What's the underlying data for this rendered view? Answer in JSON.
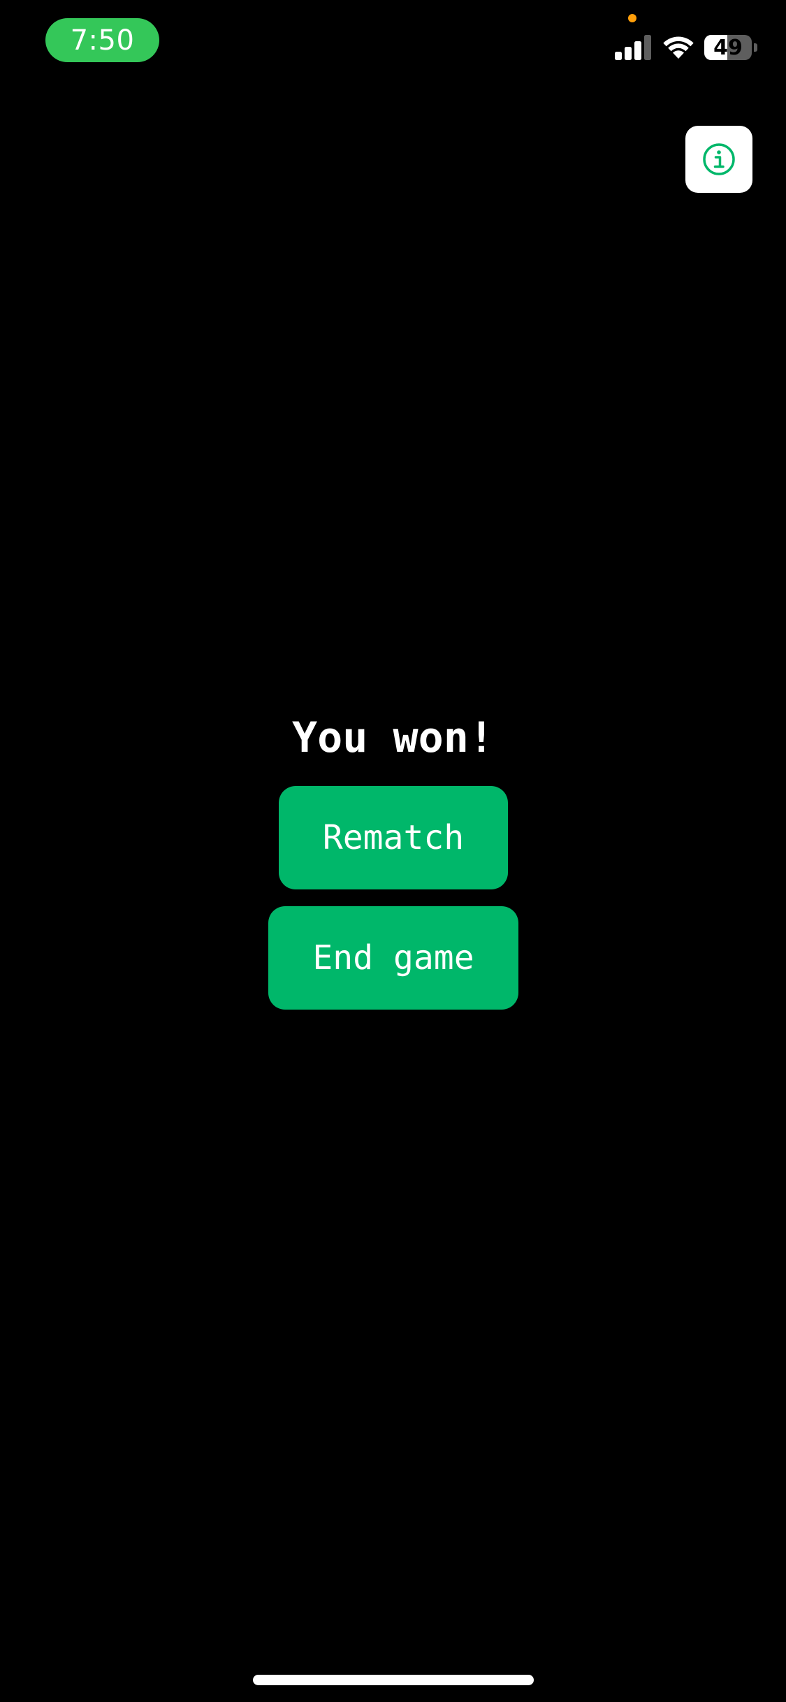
{
  "status_bar": {
    "time": "7:50",
    "time_pill_color": "#34c759",
    "mic_indicator_color": "#ff9f0a",
    "signal_icon": "cellular-signal-icon",
    "signal_bars_active": 3,
    "signal_bars_total": 4,
    "wifi_icon": "wifi-icon",
    "battery_percent": "49",
    "battery_level": 0.49
  },
  "header": {
    "info_icon": "info-circle-icon",
    "info_icon_color": "#00b76a"
  },
  "result": {
    "title": "You won!",
    "rematch_label": "Rematch",
    "end_game_label": "End game",
    "button_color": "#00b76a"
  }
}
